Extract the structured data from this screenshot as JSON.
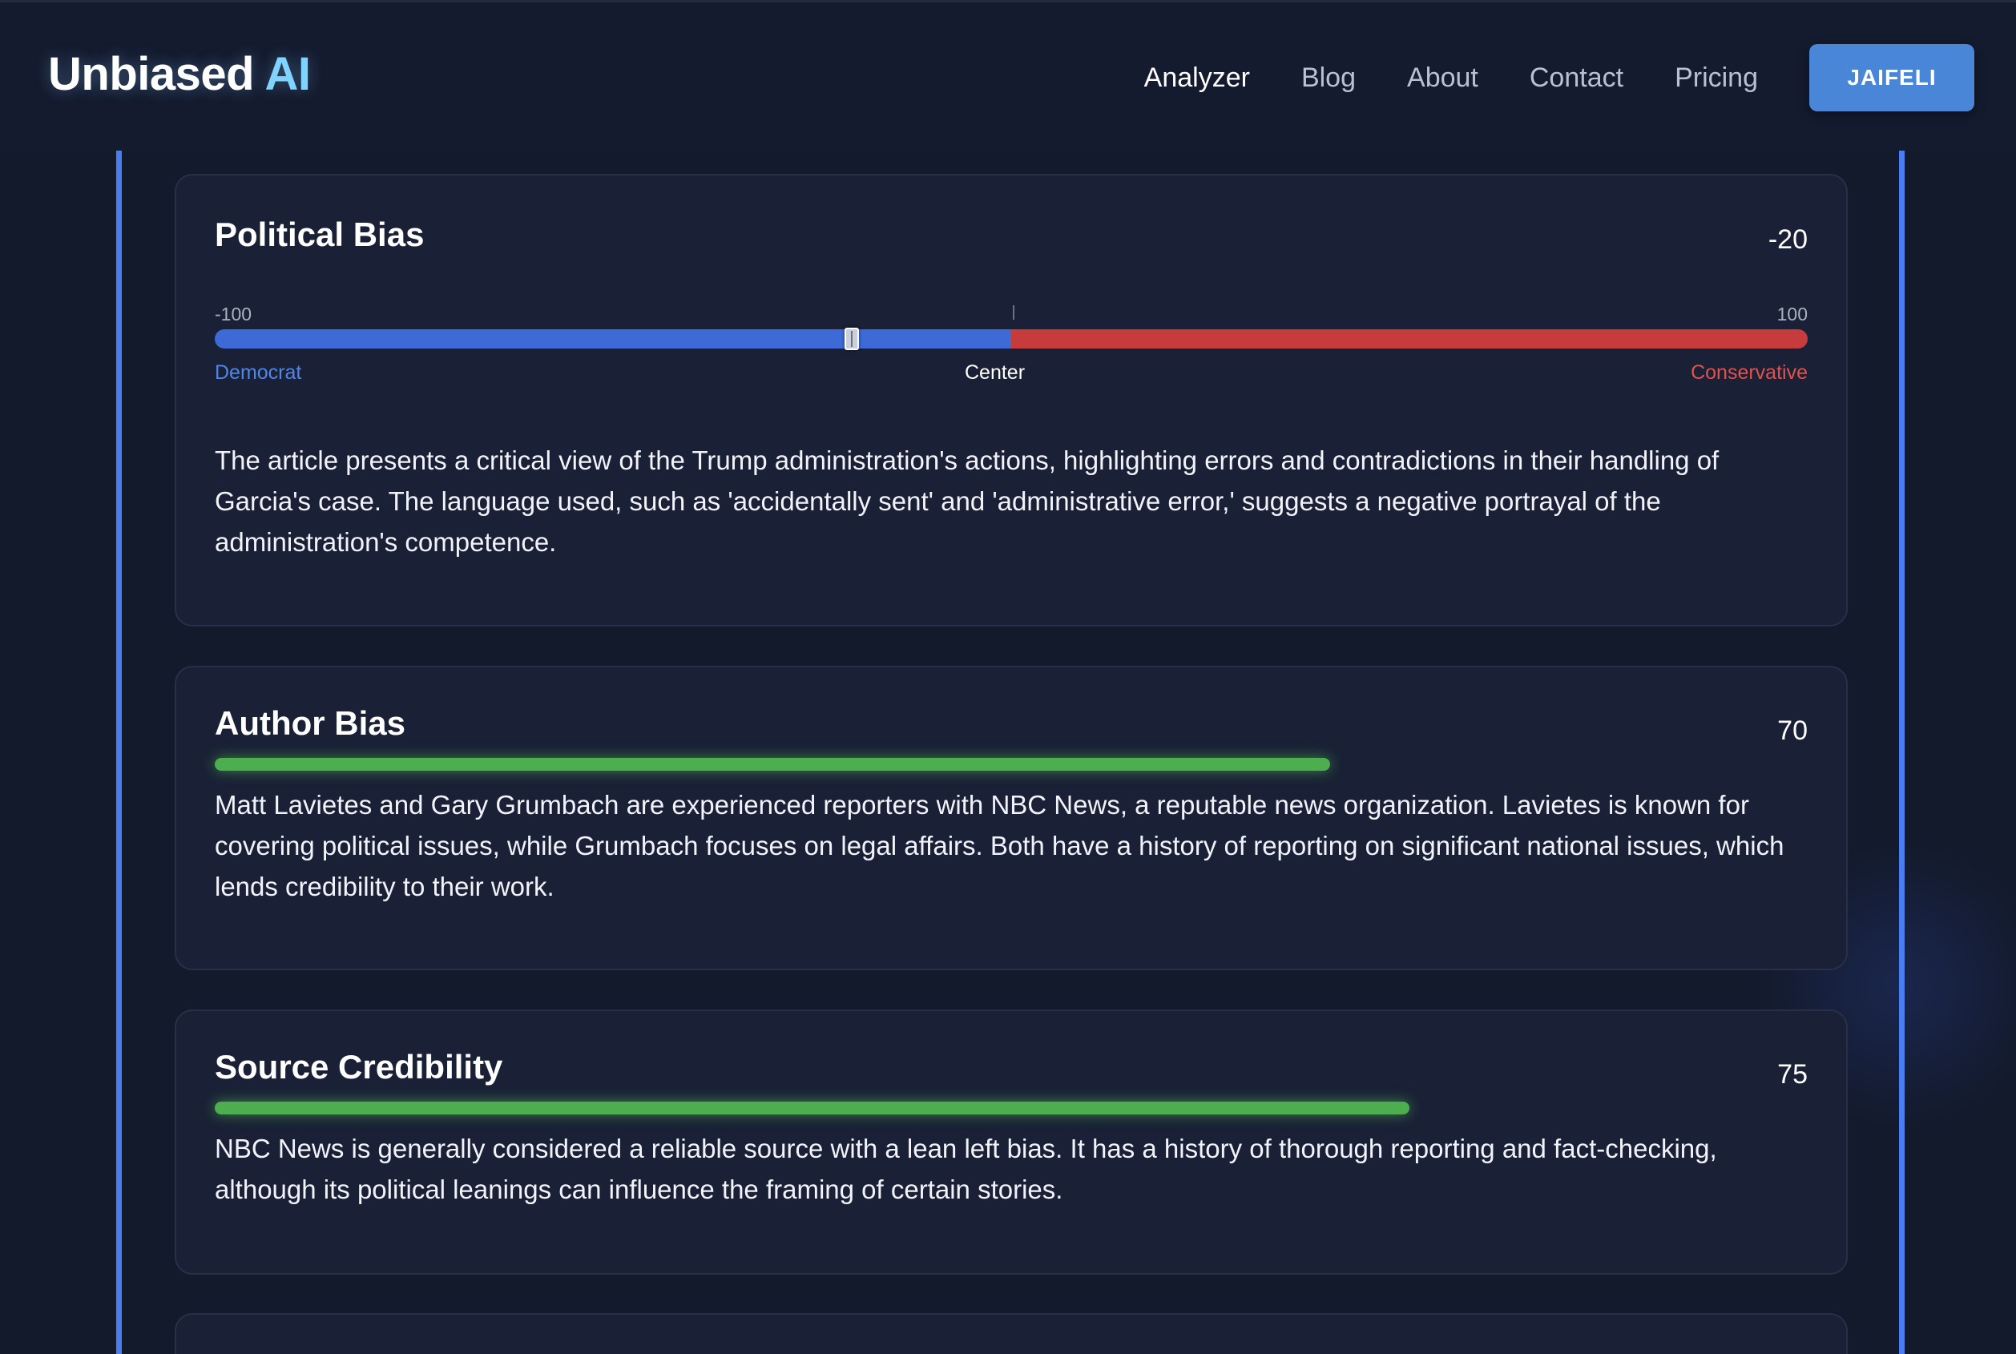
{
  "header": {
    "logo_main": "Unbiased",
    "logo_accent": "AI",
    "nav": [
      "Analyzer",
      "Blog",
      "About",
      "Contact",
      "Pricing"
    ],
    "active_nav": "Analyzer",
    "user_button": "JAIFELI"
  },
  "political_bias": {
    "title": "Political Bias",
    "score": "-20",
    "score_value": -20,
    "scale_min": "-100",
    "scale_max": "100",
    "left_label": "Democrat",
    "center_label": "Center",
    "right_label": "Conservative",
    "colors": {
      "left": "#3d6ad6",
      "right": "#c63c3c"
    },
    "text": "The article presents a critical view of the Trump administration's actions, highlighting errors and contradictions in their handling of Garcia's case. The language used, such as 'accidentally sent' and 'administrative error,' suggests a negative portrayal of the administration's competence."
  },
  "author_bias": {
    "title": "Author Bias",
    "score": "70",
    "bar_percent": 70,
    "text": "Matt Lavietes and Gary Grumbach are experienced reporters with NBC News, a reputable news organization. Lavietes is known for covering political issues, while Grumbach focuses on legal affairs. Both have a history of reporting on significant national issues, which lends credibility to their work."
  },
  "source_credibility": {
    "title": "Source Credibility",
    "score": "75",
    "bar_percent": 75,
    "text": "NBC News is generally considered a reliable source with a lean left bias. It has a history of thorough reporting and fact-checking, although its political leanings can influence the framing of certain stories."
  },
  "accent_colors": {
    "frame": "#4a7df0",
    "bar_green": "#4cae4f",
    "button": "#4a86d8"
  }
}
